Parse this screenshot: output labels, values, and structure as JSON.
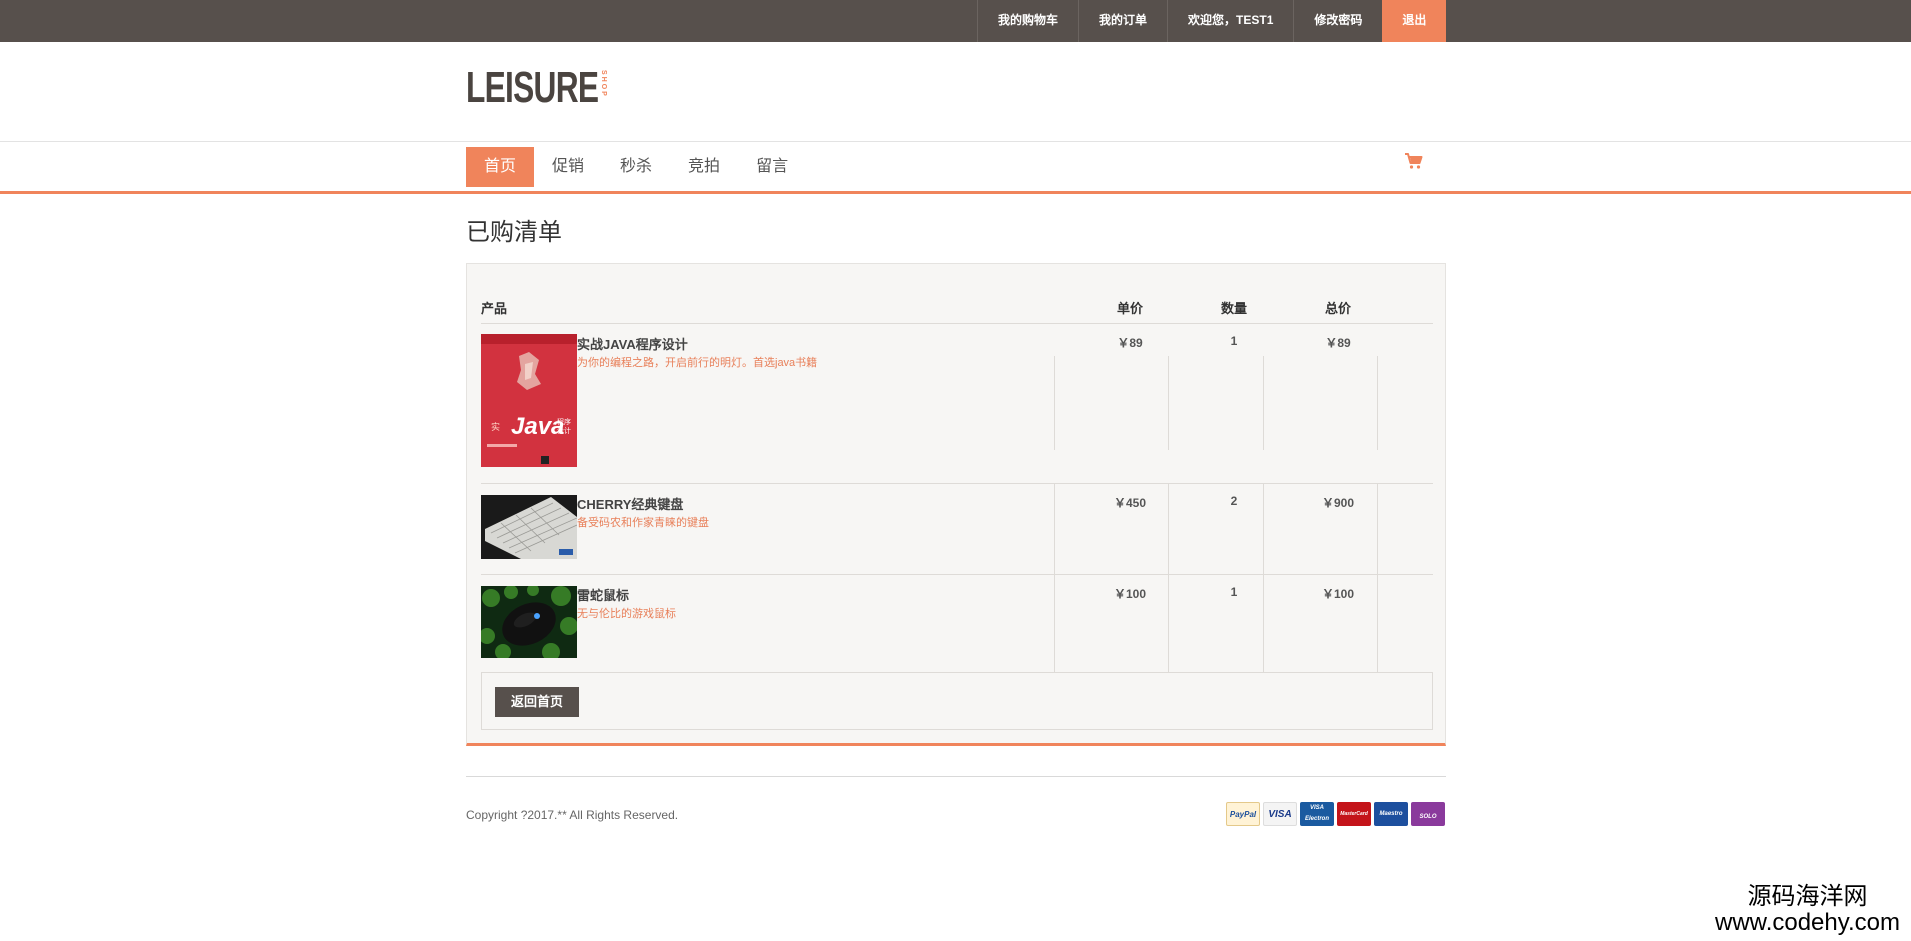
{
  "topnav": {
    "cart": "我的购物车",
    "orders": "我的订单",
    "welcome": "欢迎您，TEST1",
    "change_password": "修改密码",
    "logout": "退出"
  },
  "logo": {
    "main": "LEISURE",
    "sub": "SHOP"
  },
  "mainnav": {
    "items": [
      "首页",
      "促销",
      "秒杀",
      "竞拍",
      "留言"
    ],
    "active_index": 0
  },
  "page_title": "已购清单",
  "table": {
    "headers": {
      "product": "产品",
      "price": "单价",
      "quantity": "数量",
      "total": "总价"
    },
    "rows": [
      {
        "name": "实战JAVA程序设计",
        "desc": "为你的编程之路，开启前行的明灯。首选java书籍",
        "price": "￥89",
        "quantity": "1",
        "total": "￥89"
      },
      {
        "name": "CHERRY经典键盘",
        "desc": "备受码农和作家青睐的键盘",
        "price": "￥450",
        "quantity": "2",
        "total": "￥900"
      },
      {
        "name": "雷蛇鼠标",
        "desc": "无与伦比的游戏鼠标",
        "price": "￥100",
        "quantity": "1",
        "total": "￥100"
      }
    ]
  },
  "back_button": "返回首页",
  "copyright": "Copyright ?2017.** All Rights Reserved.",
  "payments": [
    "PayPal",
    "VISA",
    "VISA Electron",
    "MasterCard",
    "Maestro",
    "SOLO"
  ],
  "watermark": {
    "line1": "源码海洋网",
    "line2": "www.codehy.com"
  },
  "colors": {
    "accent": "#f0845b",
    "topbar": "#57504c",
    "box_bg": "#f7f6f4"
  }
}
